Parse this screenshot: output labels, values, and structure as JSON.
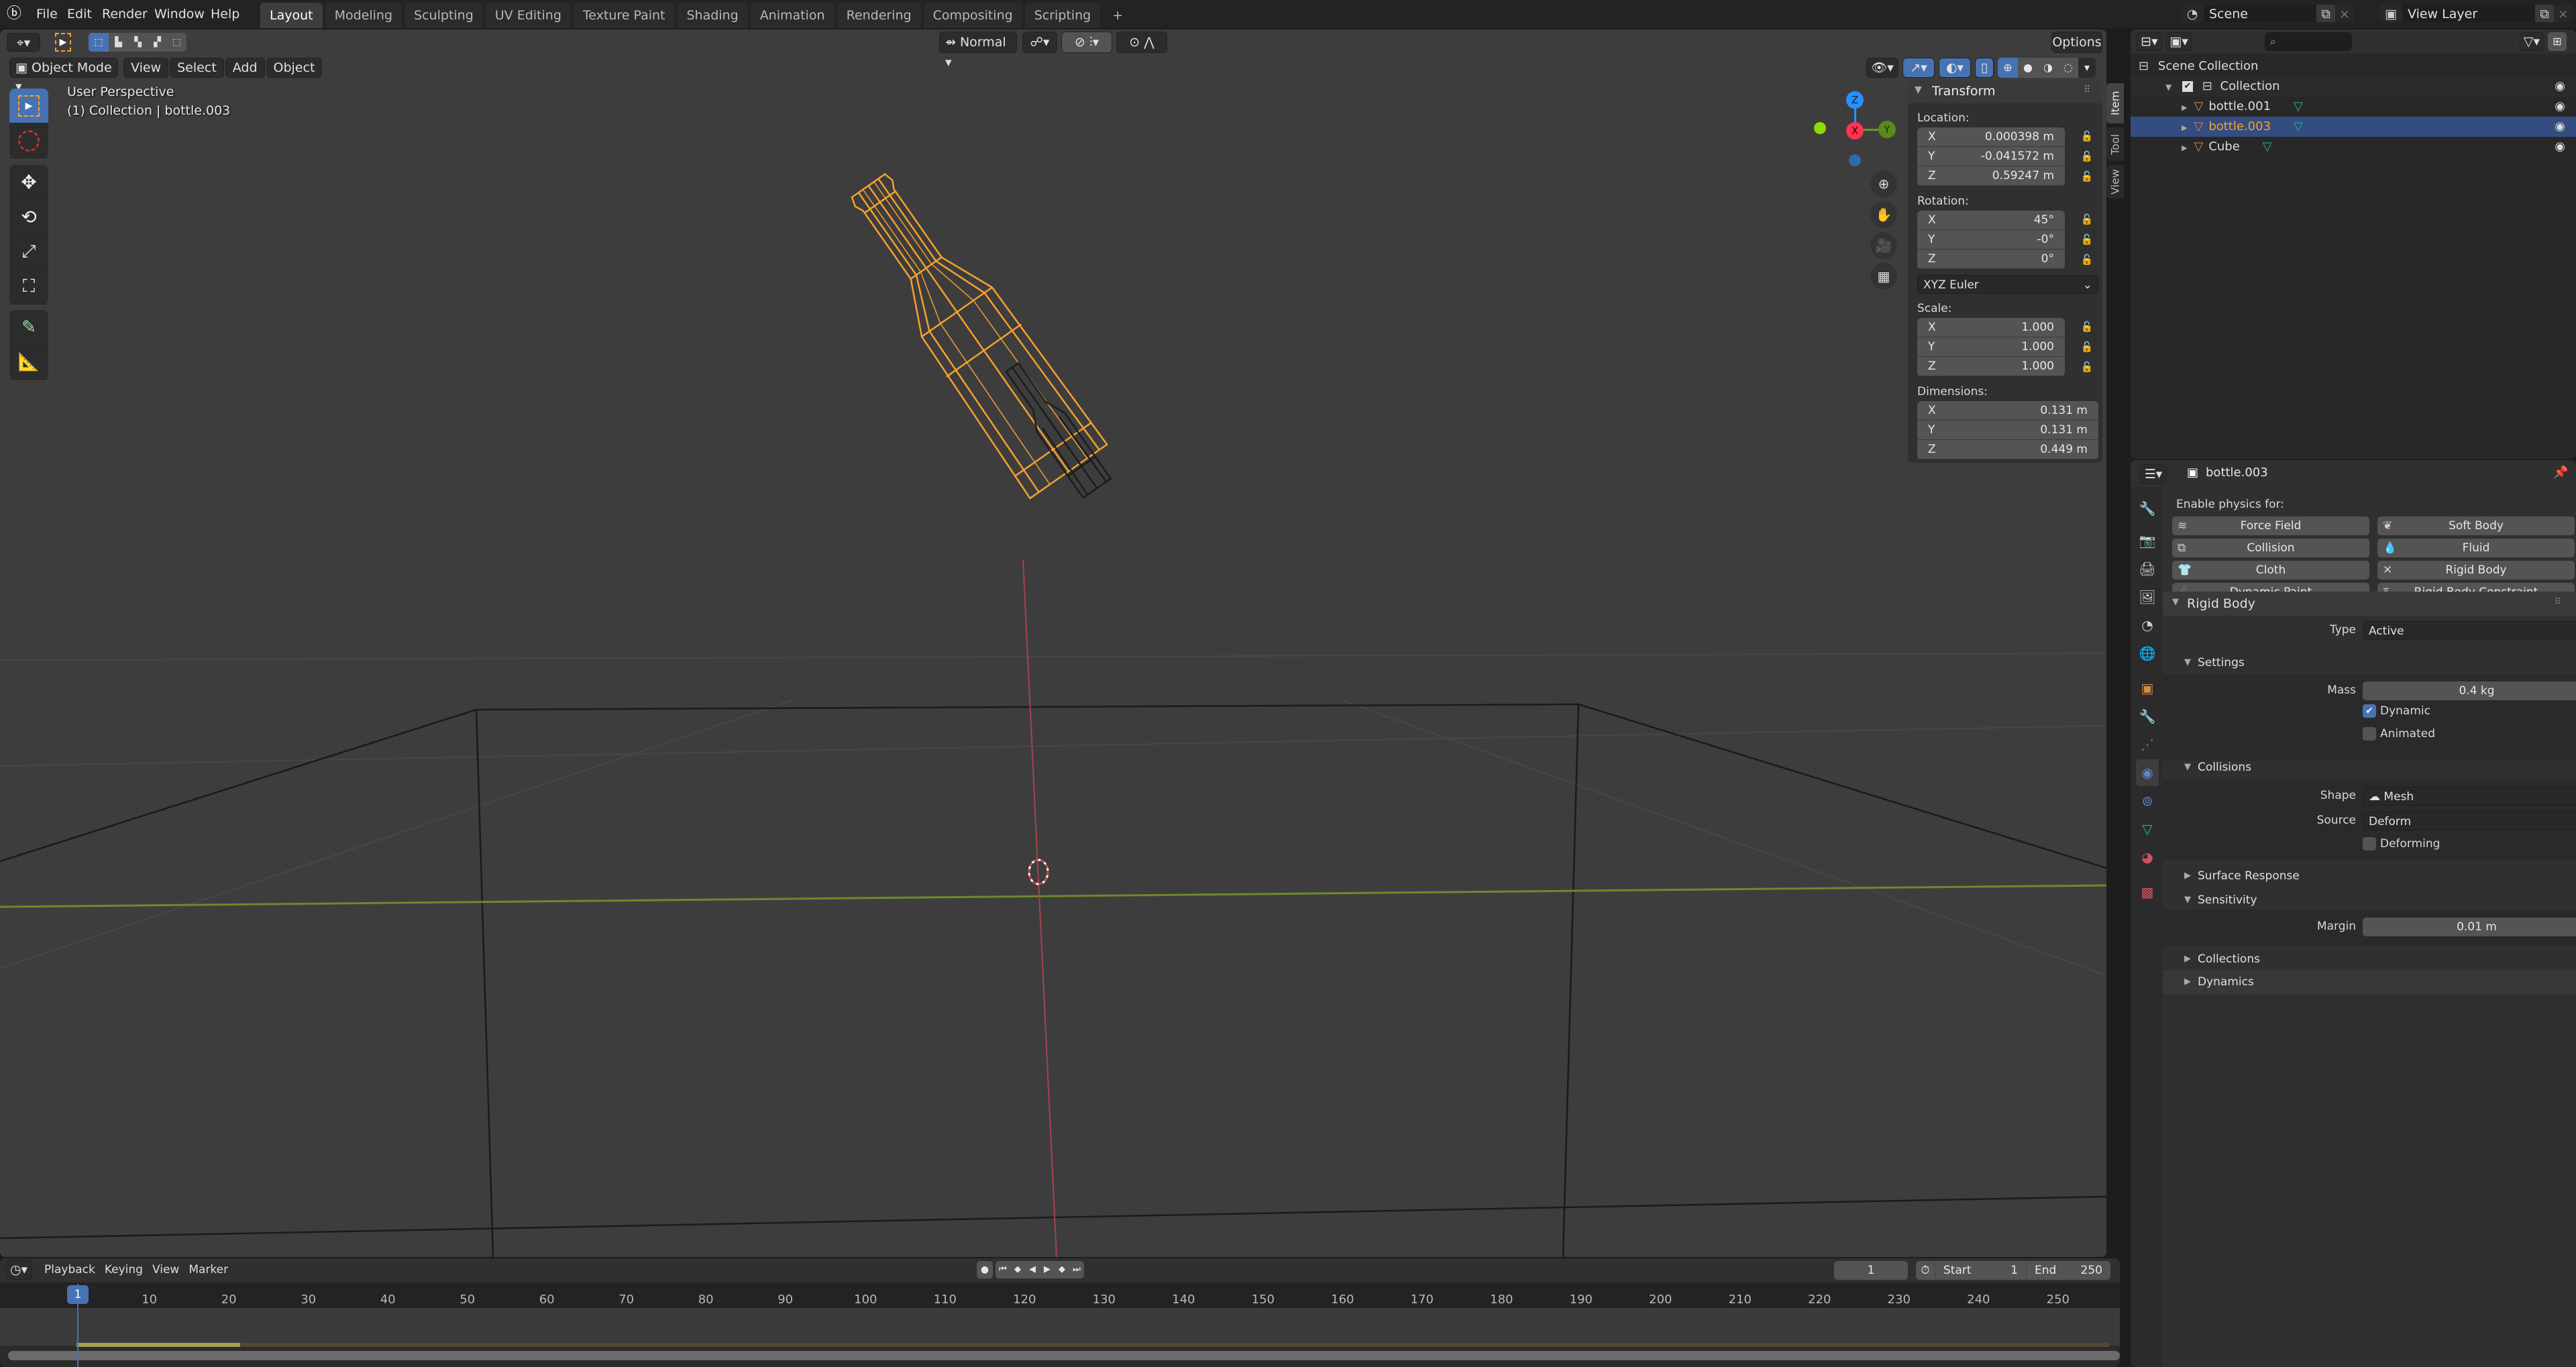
{
  "app": {
    "logo": "blender-logo-icon"
  },
  "menu": [
    "File",
    "Edit",
    "Render",
    "Window",
    "Help"
  ],
  "workspaces": [
    {
      "label": "Layout",
      "active": true
    },
    {
      "label": "Modeling"
    },
    {
      "label": "Sculpting"
    },
    {
      "label": "UV Editing"
    },
    {
      "label": "Texture Paint"
    },
    {
      "label": "Shading"
    },
    {
      "label": "Animation"
    },
    {
      "label": "Rendering"
    },
    {
      "label": "Compositing"
    },
    {
      "label": "Scripting"
    }
  ],
  "add_workspace": "+",
  "scene": {
    "label": "Scene",
    "view_layer": "View Layer"
  },
  "viewport": {
    "transform_orientation": "Normal",
    "options_label": "Options",
    "mode": "Object Mode",
    "menus": [
      "View",
      "Select",
      "Add",
      "Object"
    ],
    "overlay_title": "User Perspective",
    "overlay_sub": "(1) Collection | bottle.003",
    "gizmo": {
      "z": "Z",
      "x": "X",
      "y": "Y"
    },
    "colors": {
      "selection": "#f5a030",
      "x_axis": "#ff3352",
      "y_axis": "#8bdc00",
      "z_axis": "#2890ff"
    }
  },
  "npanel": {
    "tabs": [
      "Item",
      "Tool",
      "View"
    ],
    "section": "Transform",
    "location": {
      "label": "Location:",
      "x": "0.000398 m",
      "y": "-0.041572 m",
      "z": "0.59247 m"
    },
    "rotation": {
      "label": "Rotation:",
      "x": "45°",
      "y": "-0°",
      "z": "0°"
    },
    "rotation_mode": "XYZ Euler",
    "scale": {
      "label": "Scale:",
      "x": "1.000",
      "y": "1.000",
      "z": "1.000"
    },
    "dimensions": {
      "label": "Dimensions:",
      "x": "0.131 m",
      "y": "0.131 m",
      "z": "0.449 m"
    },
    "axes": [
      "X",
      "Y",
      "Z"
    ]
  },
  "outliner": {
    "search_placeholder": "",
    "root": "Scene Collection",
    "collection": "Collection",
    "items": [
      {
        "name": "bottle.001",
        "selected": false
      },
      {
        "name": "bottle.003",
        "selected": true
      },
      {
        "name": "Cube",
        "selected": false
      }
    ]
  },
  "properties": {
    "object_name": "bottle.003",
    "enable_label": "Enable physics for:",
    "physics_buttons": [
      {
        "label": "Force Field",
        "icon": "force-field-icon"
      },
      {
        "label": "Soft Body",
        "icon": "soft-body-icon"
      },
      {
        "label": "Collision",
        "icon": "collision-icon"
      },
      {
        "label": "Fluid",
        "icon": "fluid-icon"
      },
      {
        "label": "Cloth",
        "icon": "cloth-icon"
      },
      {
        "label": "Rigid Body",
        "icon": "remove-icon"
      },
      {
        "label": "Dynamic Paint",
        "icon": "dynamic-paint-icon"
      },
      {
        "label": "Rigid Body Constraint",
        "icon": "rigid-body-constraint-icon"
      }
    ],
    "rigid_body": {
      "title": "Rigid Body",
      "type_label": "Type",
      "type_value": "Active",
      "settings": "Settings",
      "mass_label": "Mass",
      "mass_value": "0.4 kg",
      "dynamic_label": "Dynamic",
      "dynamic_checked": true,
      "animated_label": "Animated",
      "animated_checked": false,
      "collisions": "Collisions",
      "shape_label": "Shape",
      "shape_value": "Mesh",
      "source_label": "Source",
      "source_value": "Deform",
      "deforming_label": "Deforming",
      "deforming_checked": false,
      "surface_response": "Surface Response",
      "sensitivity": "Sensitivity",
      "margin_label": "Margin",
      "margin_value": "0.01 m",
      "collections": "Collections",
      "dynamics": "Dynamics"
    }
  },
  "timeline": {
    "menus": [
      "Playback",
      "Keying",
      "View",
      "Marker"
    ],
    "current_frame": "1",
    "start_label": "Start",
    "start": "1",
    "end_label": "End",
    "end": "250",
    "ticks": [
      "1",
      "10",
      "20",
      "30",
      "40",
      "50",
      "60",
      "70",
      "80",
      "90",
      "100",
      "110",
      "120",
      "130",
      "140",
      "150",
      "160",
      "170",
      "180",
      "190",
      "200",
      "210",
      "220",
      "230",
      "240",
      "250"
    ]
  }
}
